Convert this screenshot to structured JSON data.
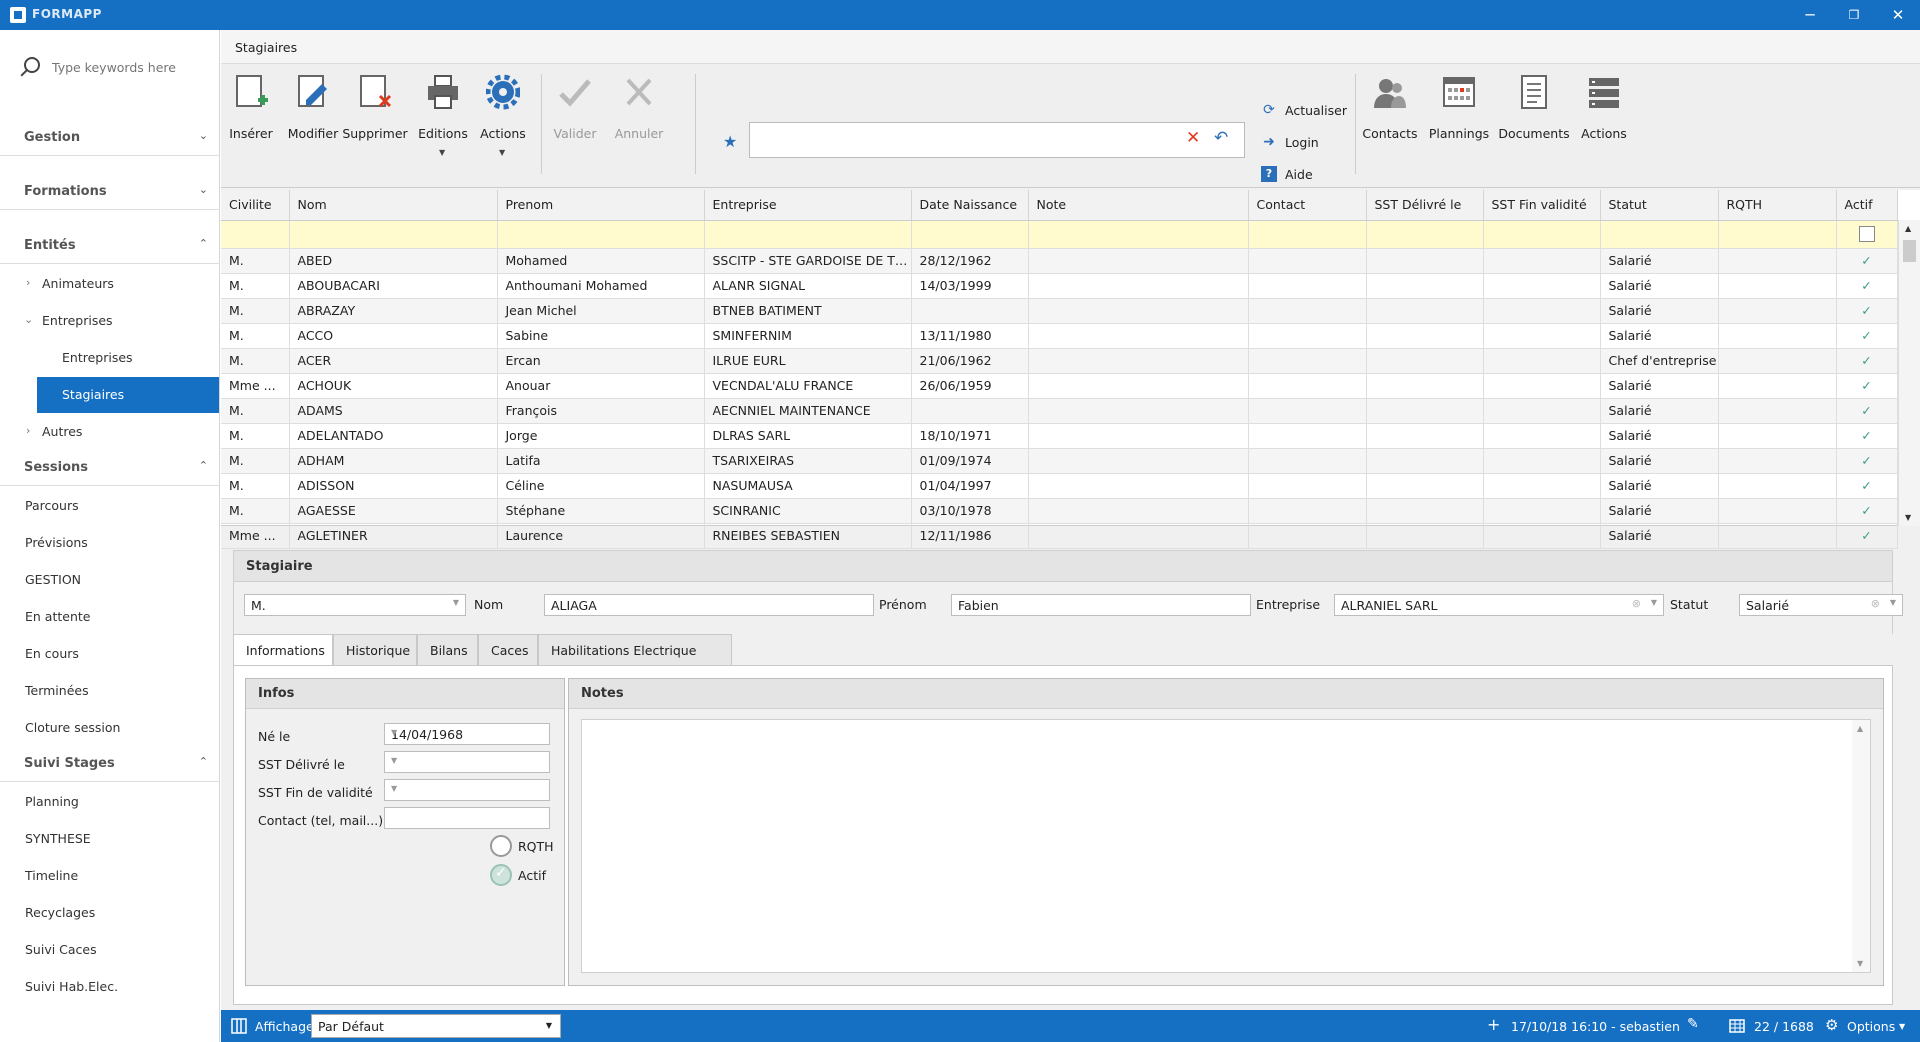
{
  "window": {
    "title": "FORMAPP",
    "minimize": "─",
    "maximize": "❐",
    "close": "✕"
  },
  "sidebar": {
    "search_placeholder": "Type keywords here",
    "groups": {
      "gestion": "Gestion",
      "formations": "Formations",
      "entites": "Entités",
      "sessions": "Sessions",
      "suivi": "Suivi Stages"
    },
    "entites_items": [
      "Animateurs",
      "Entreprises",
      "Entreprises",
      "Stagiaires",
      "Autres"
    ],
    "sessions_items": [
      "Parcours",
      "Prévisions",
      "GESTION",
      "En attente",
      "En cours",
      "Terminées",
      "Cloture session"
    ],
    "suivi_items": [
      "Planning",
      "SYNTHESE",
      "Timeline",
      "Recyclages",
      "Suivi Caces",
      "Suivi Hab.Elec."
    ]
  },
  "form": {
    "title": "Stagiaires"
  },
  "ribbon": {
    "inserer": "Insérer",
    "modifier": "Modifier",
    "supprimer": "Supprimer",
    "editions": "Editions",
    "actions": "Actions",
    "valider": "Valider",
    "annuler": "Annuler",
    "filter_value": "",
    "actualiser": "Actualiser",
    "login": "Login",
    "aide": "Aide",
    "contacts": "Contacts",
    "plannings": "Plannings",
    "documents": "Documents",
    "actions2": "Actions"
  },
  "grid": {
    "columns": [
      "Civilite",
      "Nom",
      "Prenom",
      "Entreprise",
      "Date Naissance",
      "Note",
      "Contact",
      "SST Délivré le",
      "SST Fin validité",
      "Statut",
      "RQTH",
      "Actif"
    ],
    "rows": [
      [
        "M.",
        "ABED",
        "Mohamed",
        "SSCITP - STE GARDOISE DE TR...",
        "28/12/1962",
        "",
        "",
        "",
        "",
        "Salarié",
        "",
        "✓"
      ],
      [
        "M.",
        "ABOUBACARI",
        "Anthoumani Mohamed",
        "ALANR SIGNAL",
        "14/03/1999",
        "",
        "",
        "",
        "",
        "Salarié",
        "",
        "✓"
      ],
      [
        "M.",
        "ABRAZAY",
        "Jean Michel",
        "BTNEB BATIMENT",
        "",
        "",
        "",
        "",
        "",
        "Salarié",
        "",
        "✓"
      ],
      [
        "M.",
        "ACCO",
        "Sabine",
        "SMINFERNIM",
        "13/11/1980",
        "",
        "",
        "",
        "",
        "Salarié",
        "",
        "✓"
      ],
      [
        "M.",
        "ACER",
        "Ercan",
        "ILRUE EURL",
        "21/06/1962",
        "",
        "",
        "",
        "",
        "Chef d'entreprise",
        "",
        "✓"
      ],
      [
        "Mme    ...",
        "ACHOUK",
        "Anouar",
        "VECNDAL'ALU FRANCE",
        "26/06/1959",
        "",
        "",
        "",
        "",
        "Salarié",
        "",
        "✓"
      ],
      [
        "M.",
        "ADAMS",
        "François",
        "AECNNIEL MAINTENANCE",
        "",
        "",
        "",
        "",
        "",
        "Salarié",
        "",
        "✓"
      ],
      [
        "M.",
        "ADELANTADO",
        "Jorge",
        "DLRAS SARL",
        "18/10/1971",
        "",
        "",
        "",
        "",
        "Salarié",
        "",
        "✓"
      ],
      [
        "M.",
        "ADHAM",
        "Latifa",
        "TSARIXEIRAS",
        "01/09/1974",
        "",
        "",
        "",
        "",
        "Salarié",
        "",
        "✓"
      ],
      [
        "M.",
        "ADISSON",
        "Céline",
        "NASUMAUSA",
        "01/04/1997",
        "",
        "",
        "",
        "",
        "Salarié",
        "",
        "✓"
      ],
      [
        "M.",
        "AGAESSE",
        "Stéphane",
        "SCINRANIC",
        "03/10/1978",
        "",
        "",
        "",
        "",
        "Salarié",
        "",
        "✓"
      ],
      [
        "Mme    ...",
        "AGLETINER",
        "Laurence",
        "RNEIBES SEBASTIEN",
        "12/11/1986",
        "",
        "",
        "",
        "",
        "Salarié",
        "",
        "✓"
      ]
    ]
  },
  "detail": {
    "title": "Stagiaire",
    "civilite": "M.",
    "nom_label": "Nom",
    "nom": "ALIAGA",
    "prenom_label": "Prénom",
    "prenom": "Fabien",
    "entreprise_label": "Entreprise",
    "entreprise": "ALRANIEL SARL",
    "statut_label": "Statut",
    "statut": "Salarié",
    "tabs": [
      "Informations",
      "Historique",
      "Bilans",
      "Caces",
      "Habilitations Electrique"
    ],
    "infos_title": "Infos",
    "ne_le_label": "Né le",
    "ne_le": "14/04/1968",
    "sst_delivre_label": "SST Délivré le",
    "sst_fin_label": "SST Fin de validité",
    "contact_label": "Contact (tel, mail...)",
    "rqth_label": "RQTH",
    "actif_label": "Actif",
    "notes_title": "Notes"
  },
  "status": {
    "affichage_label": "Affichage",
    "affichage_value": "Par Défaut",
    "info": "17/10/18 16:10 - sebastien",
    "count": "22 / 1688",
    "options": "Options"
  },
  "colors": {
    "accent": "#1570c4",
    "filter_row": "#fffbcf",
    "tick": "#3a9a8b"
  }
}
